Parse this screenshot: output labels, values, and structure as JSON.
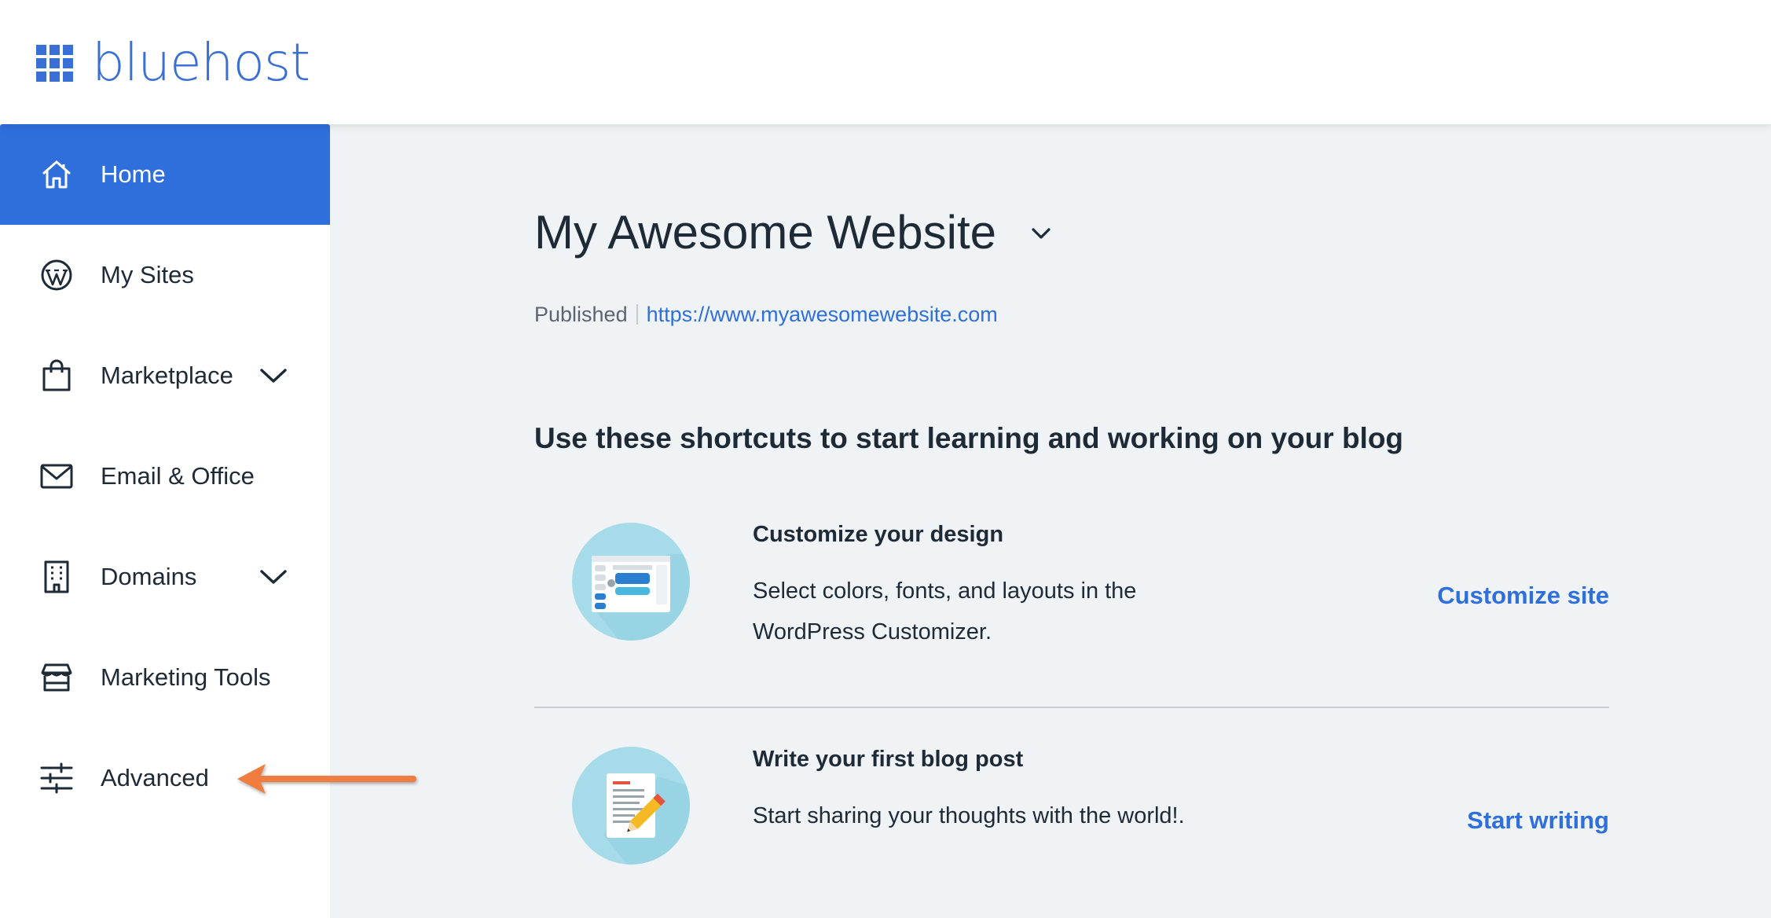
{
  "brand": {
    "name": "bluehost",
    "color": "#3a6fd6"
  },
  "sidebar": {
    "items": [
      {
        "label": "Home",
        "icon": "home-icon",
        "active": true
      },
      {
        "label": "My Sites",
        "icon": "wordpress-icon"
      },
      {
        "label": "Marketplace",
        "icon": "shopping-bag-icon",
        "expandable": true
      },
      {
        "label": "Email & Office",
        "icon": "envelope-icon"
      },
      {
        "label": "Domains",
        "icon": "building-icon",
        "expandable": true
      },
      {
        "label": "Marketing Tools",
        "icon": "storefront-icon"
      },
      {
        "label": "Advanced",
        "icon": "sliders-icon"
      }
    ]
  },
  "main": {
    "site_title": "My Awesome Website",
    "status": "Published",
    "site_url": "https://www.myawesomewebsite.com",
    "section_heading": "Use these shortcuts to start learning and working on your blog",
    "cards": [
      {
        "title": "Customize your design",
        "description": "Select colors, fonts, and layouts in the WordPress Customizer.",
        "action": "Customize site",
        "icon": "customizer-illustration"
      },
      {
        "title": "Write your first blog post",
        "description": "Start sharing your thoughts with the world!.",
        "action": "Start writing",
        "icon": "blog-post-illustration"
      }
    ]
  },
  "annotation": {
    "arrow_color": "#f07b3f",
    "points_to": "Advanced"
  },
  "colors": {
    "accent": "#2f6fdb",
    "background": "#f0f3f6",
    "text": "#1f2a37"
  }
}
